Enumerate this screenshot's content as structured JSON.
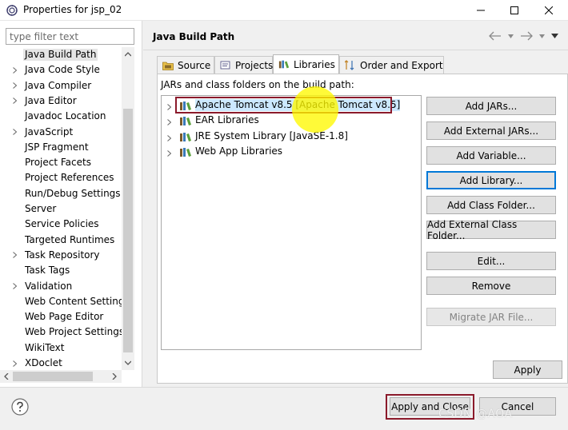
{
  "window": {
    "title": "Properties for jsp_02"
  },
  "filter": {
    "placeholder": "type filter text"
  },
  "tree": {
    "items": [
      {
        "label": "Java Build Path",
        "expandable": false,
        "selected": true
      },
      {
        "label": "Java Code Style",
        "expandable": true
      },
      {
        "label": "Java Compiler",
        "expandable": true
      },
      {
        "label": "Java Editor",
        "expandable": true
      },
      {
        "label": "Javadoc Location",
        "expandable": false
      },
      {
        "label": "JavaScript",
        "expandable": true
      },
      {
        "label": "JSP Fragment",
        "expandable": false
      },
      {
        "label": "Project Facets",
        "expandable": false
      },
      {
        "label": "Project References",
        "expandable": false
      },
      {
        "label": "Run/Debug Settings",
        "expandable": false
      },
      {
        "label": "Server",
        "expandable": false
      },
      {
        "label": "Service Policies",
        "expandable": false
      },
      {
        "label": "Targeted Runtimes",
        "expandable": false
      },
      {
        "label": "Task Repository",
        "expandable": true
      },
      {
        "label": "Task Tags",
        "expandable": false
      },
      {
        "label": "Validation",
        "expandable": true
      },
      {
        "label": "Web Content Settings",
        "expandable": false
      },
      {
        "label": "Web Page Editor",
        "expandable": false
      },
      {
        "label": "Web Project Settings",
        "expandable": false
      },
      {
        "label": "WikiText",
        "expandable": false
      },
      {
        "label": "XDoclet",
        "expandable": true
      }
    ]
  },
  "page": {
    "title": "Java Build Path"
  },
  "tabs": [
    {
      "label": "Source",
      "icon": "source-folder-icon"
    },
    {
      "label": "Projects",
      "icon": "projects-icon"
    },
    {
      "label": "Libraries",
      "icon": "libraries-icon",
      "active": true
    },
    {
      "label": "Order and Export",
      "icon": "order-export-icon"
    }
  ],
  "libraries": {
    "heading": "JARs and class folders on the build path:",
    "items": [
      {
        "label": "Apache Tomcat v8.5 [Apache Tomcat v8.5]",
        "selected": true
      },
      {
        "label": "EAR Libraries"
      },
      {
        "label": "JRE System Library [JavaSE-1.8]"
      },
      {
        "label": "Web App Libraries"
      }
    ]
  },
  "buttons": {
    "add_jars": "Add JARs...",
    "add_external_jars": "Add External JARs...",
    "add_variable": "Add Variable...",
    "add_library": "Add Library...",
    "add_class_folder": "Add Class Folder...",
    "add_external_class_folder": "Add External Class Folder...",
    "edit": "Edit...",
    "remove": "Remove",
    "migrate_jar": "Migrate JAR File...",
    "apply": "Apply",
    "apply_and_close": "Apply and Close",
    "cancel": "Cancel"
  },
  "watermark": "CSDN @AOA",
  "colors": {
    "annotation_box": "#8b1a2b",
    "highlight": "#fff800",
    "selection": "#cce8ff",
    "focus": "#0078d7"
  }
}
